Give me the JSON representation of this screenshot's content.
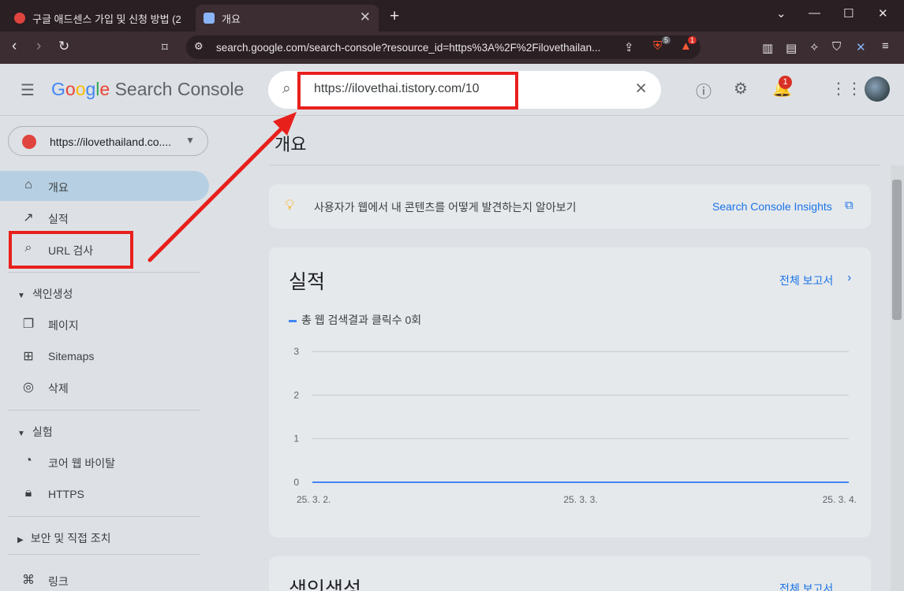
{
  "browser": {
    "tabs": [
      {
        "title": "구글 애드센스 가입 및 신청 방법 (2"
      },
      {
        "title": "개요"
      }
    ],
    "new_tab": "+",
    "url": "search.google.com/search-console?resource_id=https%3A%2F%2Filovethailan...",
    "brave_badge": "5",
    "rewards_badge": "1"
  },
  "header": {
    "logo_google": [
      "G",
      "o",
      "o",
      "g",
      "l",
      "e"
    ],
    "logo_product": "Search Console",
    "search_value": "https://ilovethai.tistory.com/10",
    "notification_count": "1"
  },
  "sidebar": {
    "property": "https://ilovethailand.co....",
    "items": [
      {
        "label": "개요"
      },
      {
        "label": "실적"
      },
      {
        "label": "URL 검사"
      }
    ],
    "sections": [
      {
        "label": "색인생성",
        "items": [
          {
            "label": "페이지"
          },
          {
            "label": "Sitemaps"
          },
          {
            "label": "삭제"
          }
        ]
      },
      {
        "label": "실험",
        "items": [
          {
            "label": "코어 웹 바이탈"
          },
          {
            "label": "HTTPS"
          }
        ]
      },
      {
        "label": "보안 및 직접 조치",
        "items": []
      }
    ],
    "links_label": "링크"
  },
  "main": {
    "title": "개요",
    "insight_text": "사용자가 웹에서 내 콘텐츠를 어떻게 발견하는지 알아보기",
    "insight_link": "Search Console Insights",
    "performance": {
      "title": "실적",
      "report_link": "전체 보고서",
      "legend": "총 웹 검색결과 클릭수 0회"
    },
    "indexing": {
      "title": "색인생성",
      "report_link": "전체 보고서"
    }
  },
  "chart_data": {
    "type": "line",
    "x": [
      "25. 3. 2.",
      "25. 3. 3.",
      "25. 3. 4."
    ],
    "series": [
      {
        "name": "총 웹 검색결과 클릭수 0회",
        "values": [
          0,
          0,
          0
        ]
      }
    ],
    "yticks": [
      "3",
      "2",
      "1",
      "0"
    ],
    "ylim": [
      0,
      3
    ],
    "color": "#4285f4",
    "grid": true
  }
}
